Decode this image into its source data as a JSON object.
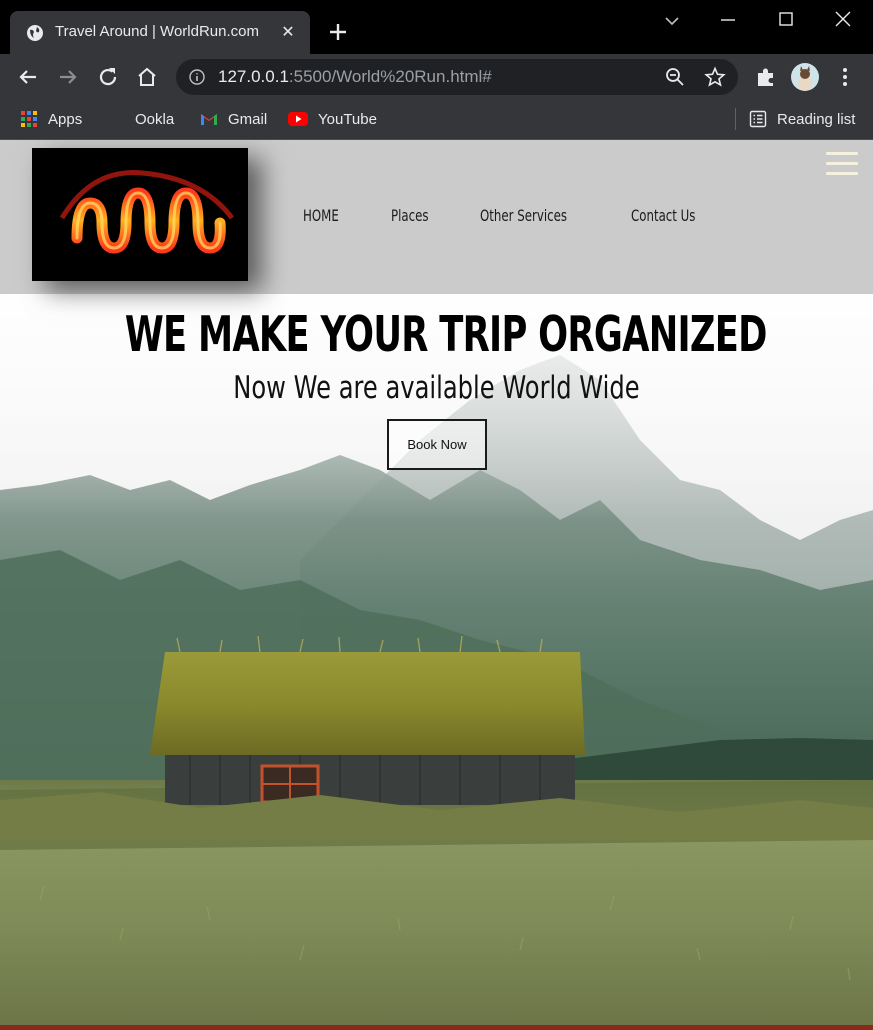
{
  "browser": {
    "tab": {
      "title": "Travel Around | WorldRun.com"
    },
    "address": {
      "host": "127.0.0.1",
      "rest": ":5500/World%20Run.html#"
    },
    "bookmarks": [
      {
        "label": "Apps",
        "icon": "apps-grid-icon"
      },
      {
        "label": "Ookla",
        "icon": "ookla-icon"
      },
      {
        "label": "Gmail",
        "icon": "gmail-icon"
      },
      {
        "label": "YouTube",
        "icon": "youtube-icon"
      }
    ],
    "reading_list": "Reading list"
  },
  "site": {
    "nav": [
      "HOME",
      "Places",
      "Other Services",
      "Contact Us"
    ],
    "hero": {
      "title": "WE MAKE YOUR TRIP ORGANIZED",
      "subtitle": "Now We are available World Wide",
      "cta": "Book Now"
    }
  },
  "colors": {
    "header_bg": "#cbcbcb",
    "chrome_dark": "#35363a",
    "logo_glow": "#ff3a1a"
  }
}
